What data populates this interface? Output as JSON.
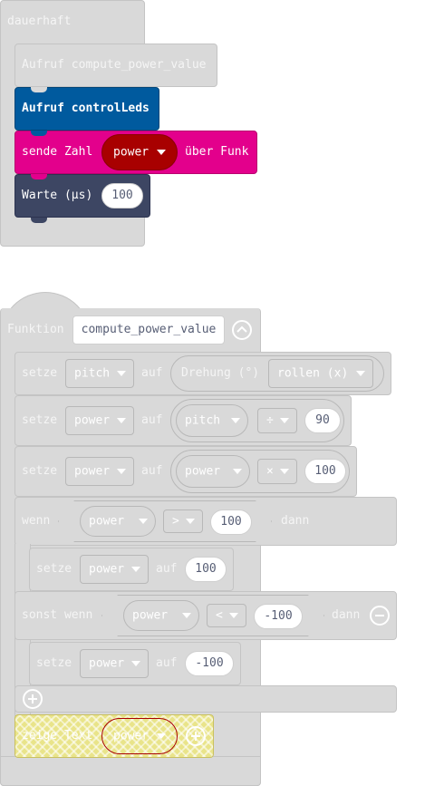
{
  "forever": {
    "label": "dauerhaft",
    "call1": "Aufruf compute_power_value",
    "call2": "Aufruf controlLeds",
    "radio": {
      "prefix": "sende Zahl",
      "var": "power",
      "suffix": "über Funk"
    },
    "pause": {
      "label": "Warte (µs)",
      "value": "100"
    }
  },
  "function": {
    "keyword": "Funktion",
    "name": "compute_power_value",
    "set1": {
      "set": "setze",
      "var": "pitch",
      "to": "auf",
      "sensor": "Drehung (°)",
      "axis": "rollen (x)"
    },
    "set2": {
      "set": "setze",
      "var": "power",
      "to": "auf",
      "left": "pitch",
      "op": "÷",
      "right": "90"
    },
    "set3": {
      "set": "setze",
      "var": "power",
      "to": "auf",
      "left": "power",
      "op": "×",
      "right": "100"
    },
    "if": {
      "keyword": "wenn",
      "left": "power",
      "op": ">",
      "right": "100",
      "then": "dann"
    },
    "set4": {
      "set": "setze",
      "var": "power",
      "to": "auf",
      "value": "100"
    },
    "elseif": {
      "keyword": "sonst wenn",
      "left": "power",
      "op": "<",
      "right": "-100",
      "then": "dann"
    },
    "set5": {
      "set": "setze",
      "var": "power",
      "to": "auf",
      "value": "-100"
    },
    "show": {
      "label": "zeige Text",
      "var": "power"
    }
  },
  "icons": {
    "collapse": "chevron-up-icon",
    "remove": "minus-circle-icon",
    "add": "plus-circle-icon",
    "dropdown": "caret-down-icon"
  },
  "colors": {
    "ghost_block": "#d9d9d9",
    "functions_blue": "#005a9e",
    "radio_pink": "#e3008c",
    "variable_dark_red": "#a80000",
    "pause_slate": "#3d4663",
    "text_on_light": "#575e75",
    "highlight_yellow": "#f5e96b"
  }
}
